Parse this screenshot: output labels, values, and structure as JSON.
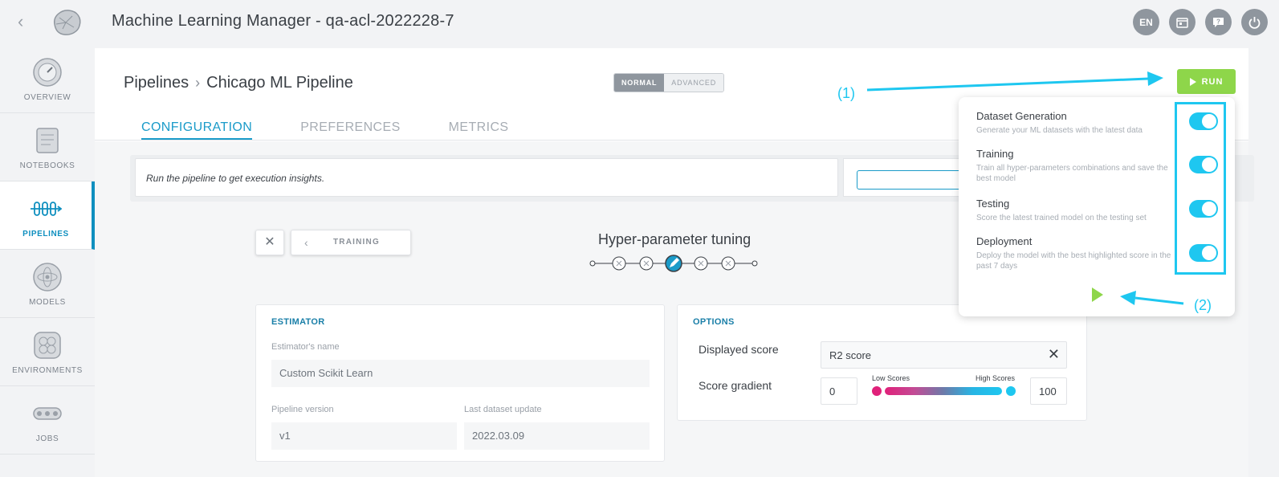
{
  "app": {
    "title": "Machine Learning Manager - qa-acl-2022228-7",
    "lang_label": "EN"
  },
  "sidebar": {
    "items": [
      {
        "label": "OVERVIEW",
        "icon": "gauge-icon"
      },
      {
        "label": "NOTEBOOKS",
        "icon": "notebook-icon"
      },
      {
        "label": "PIPELINES",
        "icon": "pipeline-icon",
        "active": true
      },
      {
        "label": "MODELS",
        "icon": "atom-icon"
      },
      {
        "label": "ENVIRONMENTS",
        "icon": "hexagon-grid-icon"
      },
      {
        "label": "JOBS",
        "icon": "conveyor-icon"
      }
    ]
  },
  "breadcrumb": {
    "root": "Pipelines",
    "current": "Chicago ML Pipeline"
  },
  "mode": {
    "normal": "NORMAL",
    "advanced": "ADVANCED"
  },
  "tabs": [
    "CONFIGURATION",
    "PREFERENCES",
    "METRICS"
  ],
  "run_button": {
    "label": "RUN"
  },
  "insights": {
    "text": "Run the pipeline to get execution insights."
  },
  "step_nav": {
    "back_label": "TRAINING",
    "title": "Hyper-parameter tuning"
  },
  "estimator": {
    "section_title": "ESTIMATOR",
    "name_label": "Estimator's name",
    "name_value": "Custom Scikit Learn",
    "version_label": "Pipeline version",
    "version_value": "v1",
    "dataset_label": "Last dataset update",
    "dataset_value": "2022.03.09"
  },
  "options": {
    "section_title": "OPTIONS",
    "displayed_score_label": "Displayed score",
    "displayed_score_value": "R2 score",
    "score_gradient_label": "Score gradient",
    "gradient_min": "0",
    "gradient_max": "100",
    "low_label": "Low Scores",
    "high_label": "High Scores",
    "low_color": "#e0217a",
    "high_color": "#1ec7f0"
  },
  "run_popover": {
    "items": [
      {
        "title": "Dataset Generation",
        "desc": "Generate your ML datasets with the latest data",
        "enabled": true
      },
      {
        "title": "Training",
        "desc": "Train all hyper-parameters combinations and save the best model",
        "enabled": true
      },
      {
        "title": "Testing",
        "desc": "Score the latest trained model on the testing set",
        "enabled": true
      },
      {
        "title": "Deployment",
        "desc": "Deploy the model with the best highlighted score in the past 7 days",
        "enabled": true
      }
    ]
  },
  "annotations": {
    "one": "(1)",
    "two": "(2)"
  },
  "colors": {
    "accent": "#1a9bc9",
    "run_green": "#8ed64a",
    "annotation_cyan": "#1ec7f0"
  }
}
